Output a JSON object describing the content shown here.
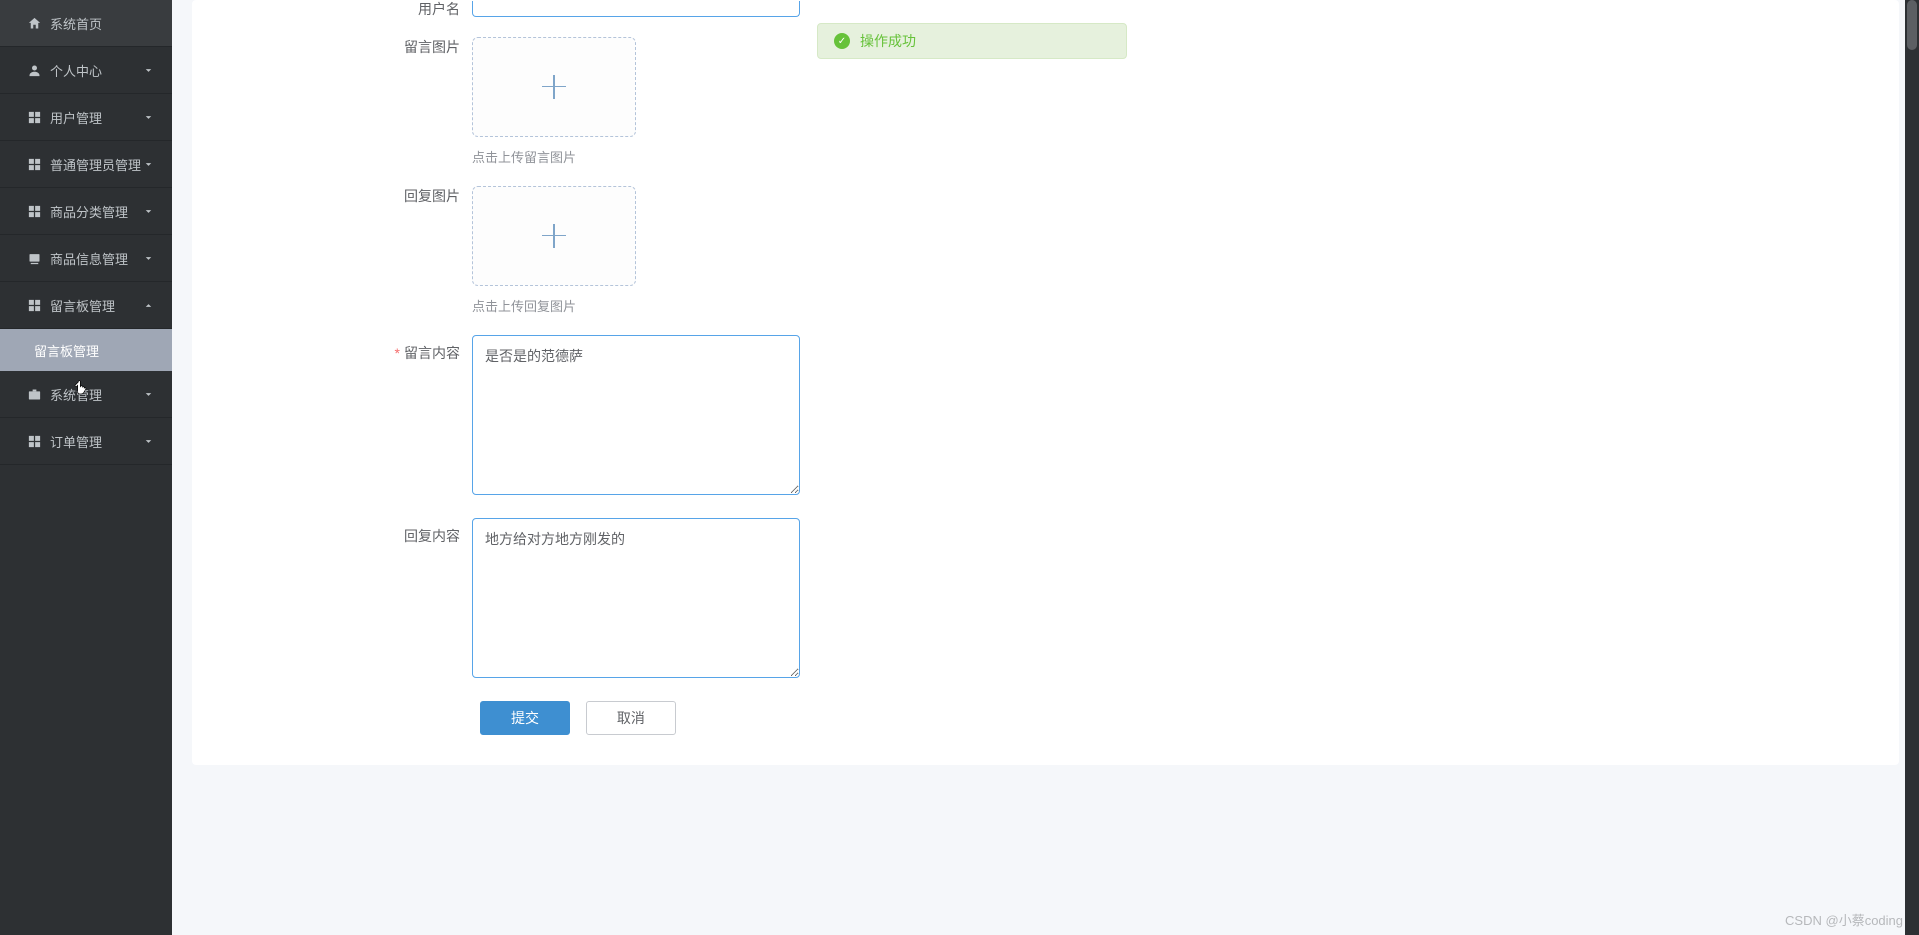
{
  "sidebar": {
    "items": [
      {
        "label": "系统首页",
        "icon": "home",
        "expandable": false
      },
      {
        "label": "个人中心",
        "icon": "user",
        "expandable": true
      },
      {
        "label": "用户管理",
        "icon": "grid",
        "expandable": true
      },
      {
        "label": "普通管理员管理",
        "icon": "grid",
        "expandable": true
      },
      {
        "label": "商品分类管理",
        "icon": "grid",
        "expandable": true
      },
      {
        "label": "商品信息管理",
        "icon": "layers",
        "expandable": true
      },
      {
        "label": "留言板管理",
        "icon": "grid",
        "expandable": true,
        "open": true,
        "children": [
          {
            "label": "留言板管理",
            "active": true
          }
        ]
      },
      {
        "label": "系统管理",
        "icon": "briefcase",
        "expandable": true
      },
      {
        "label": "订单管理",
        "icon": "grid",
        "expandable": true
      }
    ]
  },
  "form": {
    "username_label": "用户名",
    "username_value": "",
    "msg_image_label": "留言图片",
    "msg_image_hint": "点击上传留言图片",
    "reply_image_label": "回复图片",
    "reply_image_hint": "点击上传回复图片",
    "msg_content_label": "留言内容",
    "msg_content_value": "是否是的范德萨",
    "reply_content_label": "回复内容",
    "reply_content_value": "地方给对方地方刚发的",
    "submit_label": "提交",
    "cancel_label": "取消"
  },
  "toast": {
    "message": "操作成功"
  },
  "watermark": "CSDN @小蔡coding"
}
